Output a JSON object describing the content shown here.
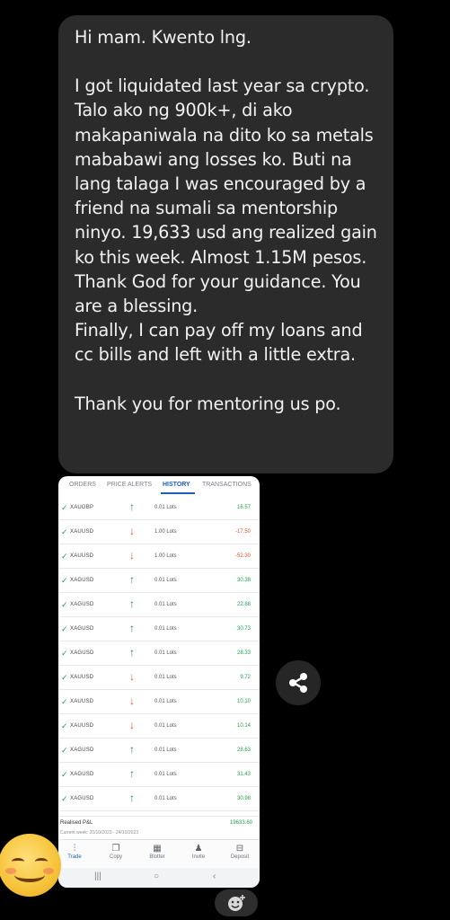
{
  "message": {
    "paragraphs": [
      "Hi mam. Kwento lng.",
      "",
      "I got liquidated last year sa crypto. Talo ako ng 900k+,  di ako makapaniwala na dito ko sa metals mababawi ang losses ko. Buti na lang talaga I was encouraged by a friend na sumali sa mentorship ninyo. 19,633 usd ang realized gain ko this week. Almost 1.15M pesos. Thank God for your guidance. You are a blessing.",
      "Finally, I can pay off my loans and cc bills and left with a little extra.",
      "",
      "Thank you for mentoring us po."
    ]
  },
  "trading_app": {
    "tabs": [
      "ORDERS",
      "PRICE ALERTS",
      "HISTORY",
      "TRANSACTIONS"
    ],
    "active_tab": "HISTORY",
    "rows": [
      {
        "symbol": "XAUGBP",
        "direction": "up",
        "lots": "0.01 Lots",
        "pl": "16.57",
        "sign": "pos"
      },
      {
        "symbol": "XAUUSD",
        "direction": "down",
        "lots": "1.00 Lots",
        "pl": "-17.50",
        "sign": "neg"
      },
      {
        "symbol": "XAUUSD",
        "direction": "down",
        "lots": "1.00 Lots",
        "pl": "-52.30",
        "sign": "neg"
      },
      {
        "symbol": "XAGUSD",
        "direction": "up",
        "lots": "0.01 Lots",
        "pl": "30.38",
        "sign": "pos"
      },
      {
        "symbol": "XAGUSD",
        "direction": "up",
        "lots": "0.01 Lots",
        "pl": "22.88",
        "sign": "pos"
      },
      {
        "symbol": "XAGUSD",
        "direction": "up",
        "lots": "0.01 Lots",
        "pl": "30.73",
        "sign": "pos"
      },
      {
        "symbol": "XAGUSD",
        "direction": "up",
        "lots": "0.01 Lots",
        "pl": "28.33",
        "sign": "pos"
      },
      {
        "symbol": "XAUUSD",
        "direction": "down",
        "lots": "0.01 Lots",
        "pl": "9.72",
        "sign": "pos"
      },
      {
        "symbol": "XAUUSD",
        "direction": "down",
        "lots": "0.01 Lots",
        "pl": "10.10",
        "sign": "pos"
      },
      {
        "symbol": "XAUUSD",
        "direction": "down",
        "lots": "0.01 Lots",
        "pl": "10.14",
        "sign": "pos"
      },
      {
        "symbol": "XAGUSD",
        "direction": "up",
        "lots": "0.01 Lots",
        "pl": "28.63",
        "sign": "pos"
      },
      {
        "symbol": "XAGUSD",
        "direction": "up",
        "lots": "0.01 Lots",
        "pl": "31.43",
        "sign": "pos"
      },
      {
        "symbol": "XAGUSD",
        "direction": "up",
        "lots": "0.01 Lots",
        "pl": "30.98",
        "sign": "pos"
      }
    ],
    "summary": {
      "label": "Realised P&L",
      "value": "19633.60",
      "week": "Current week: 20/10/2023 - 24/10/2023"
    },
    "bottom_nav": [
      {
        "label": "Trade",
        "icon": "trade-icon",
        "glyph": "⫶"
      },
      {
        "label": "Copy",
        "icon": "copy-icon",
        "glyph": "❐"
      },
      {
        "label": "Blotter",
        "icon": "blotter-icon",
        "glyph": "▦"
      },
      {
        "label": "Invite",
        "icon": "invite-icon",
        "glyph": "♟"
      },
      {
        "label": "Deposit",
        "icon": "deposit-icon",
        "glyph": "⊟"
      }
    ],
    "active_nav": "Trade",
    "system_nav": [
      "|||",
      "○",
      "‹"
    ]
  },
  "icons": {
    "share": "share-icon",
    "reaction": "add-reaction-icon",
    "emoji": "smiling-face-emoji"
  },
  "colors": {
    "bubble": "#2b2b2c",
    "accent": "#1f5fb8",
    "profit": "#22a04b",
    "loss": "#e0572b"
  }
}
